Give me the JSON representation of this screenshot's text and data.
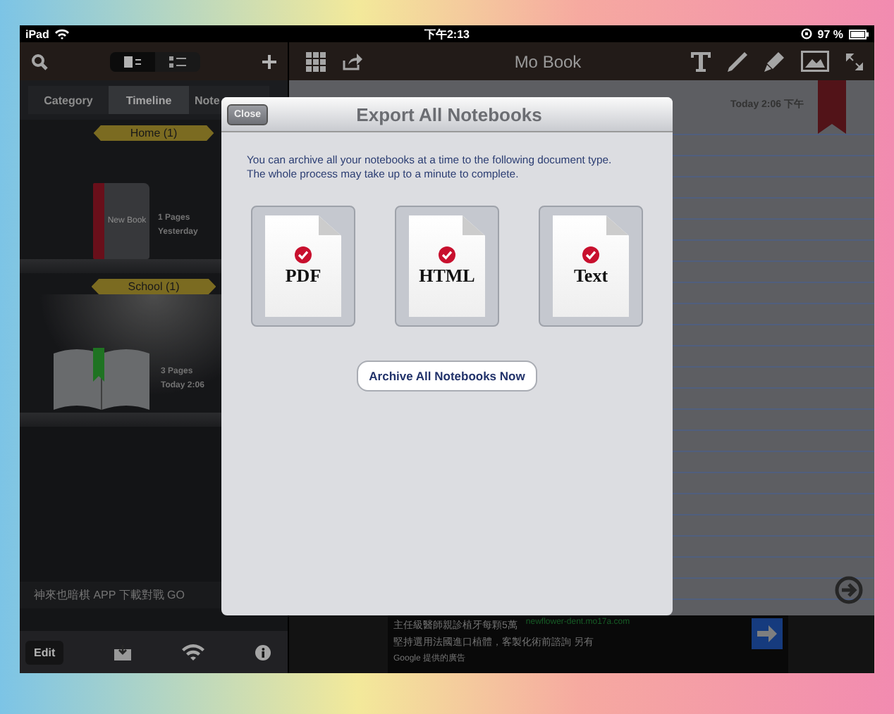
{
  "status_bar": {
    "device": "iPad",
    "time": "下午2:13",
    "battery": "97 %"
  },
  "sidebar": {
    "tabs": [
      {
        "label": "Category",
        "selected": false
      },
      {
        "label": "Timeline",
        "selected": true
      },
      {
        "label": "Note",
        "selected": false
      }
    ],
    "shelves": [
      {
        "label": "Home (1)",
        "book": {
          "kind": "closed",
          "title": "New Book",
          "pages": "1 Pages",
          "date": "Yesterday"
        }
      },
      {
        "label": "School (1)",
        "book": {
          "kind": "open",
          "pages": "3 Pages",
          "date": "Today 2:06"
        }
      }
    ],
    "ad": "神來也暗棋 APP 下載對戰 GO",
    "edit_button": "Edit"
  },
  "toolbar": {
    "title": "Mo Book"
  },
  "note": {
    "date": "Today 2:06 下午"
  },
  "dialog": {
    "close_button": "Close",
    "title": "Export All Notebooks",
    "message_lines": [
      "You can archive all your notebooks at a time to the following document type.",
      "The whole process may take up to a minute to complete."
    ],
    "formats": [
      {
        "label": "PDF",
        "checked": true
      },
      {
        "label": "HTML",
        "checked": true
      },
      {
        "label": "Text",
        "checked": true
      }
    ],
    "archive_button": "Archive All Notebooks Now"
  },
  "bottom_ad": {
    "headline": "主任級醫師親診植牙每顆5萬",
    "url": "newflower-dent.mo17a.com",
    "body": "堅持選用法國進口植體，客製化術前諮詢 另有",
    "attribution": "Google 提供的廣告"
  }
}
